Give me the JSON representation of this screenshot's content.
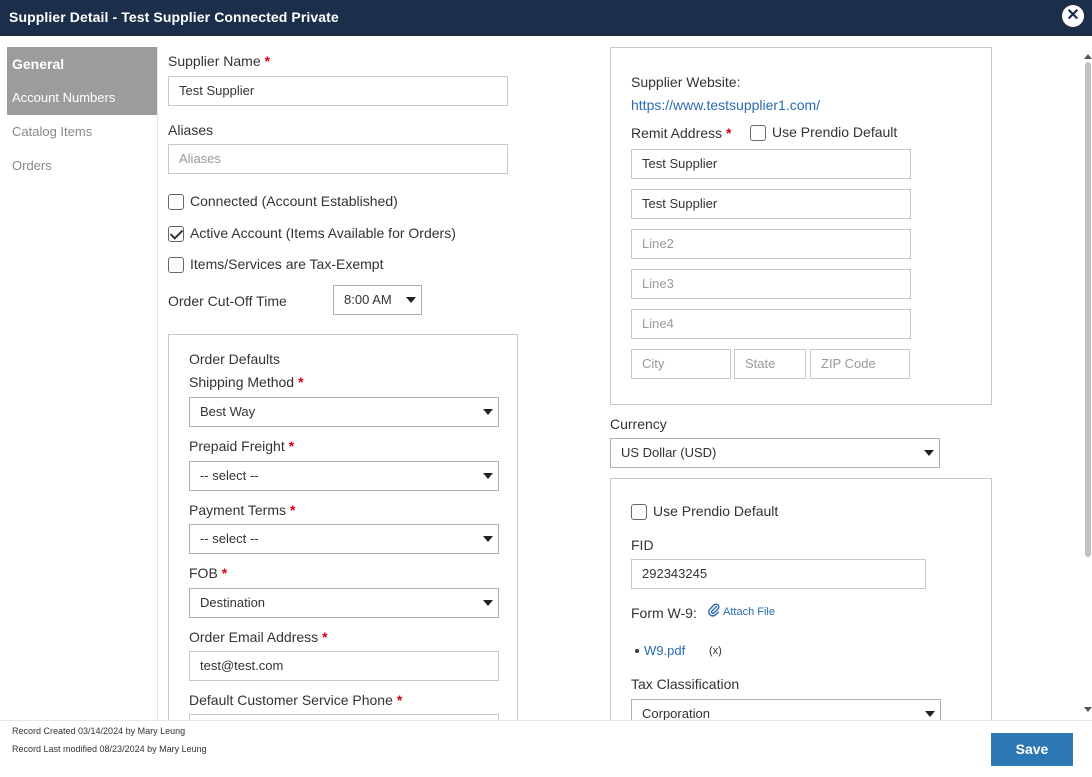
{
  "window": {
    "title": "Supplier Detail - Test Supplier Connected Private"
  },
  "nav": {
    "items": [
      "General",
      "Account Numbers",
      "Catalog Items",
      "Orders"
    ]
  },
  "form": {
    "supplier_name": {
      "label": "Supplier Name",
      "value": "Test Supplier"
    },
    "aliases": {
      "label": "Aliases",
      "placeholder": "Aliases"
    },
    "checkboxes": {
      "connected": {
        "label": "Connected (Account Established)",
        "checked": false
      },
      "active": {
        "label": "Active Account (Items Available for Orders)",
        "checked": true
      },
      "tax_exempt": {
        "label": "Items/Services are Tax-Exempt",
        "checked": false
      }
    },
    "cutoff": {
      "label": "Order Cut-Off Time",
      "value": "8:00 AM"
    }
  },
  "order_defaults": {
    "heading": "Order Defaults",
    "shipping_method": {
      "label": "Shipping Method",
      "value": "Best Way"
    },
    "prepaid_freight": {
      "label": "Prepaid Freight",
      "value": "-- select --"
    },
    "payment_terms": {
      "label": "Payment Terms",
      "value": "-- select --"
    },
    "fob": {
      "label": "FOB",
      "value": "Destination"
    },
    "order_email": {
      "label": "Order Email Address",
      "value": "test@test.com"
    },
    "cs_phone": {
      "label": "Default Customer Service Phone"
    }
  },
  "address": {
    "website_label": "Supplier Website:",
    "website": "https://www.testsupplier1.com/",
    "remit_label": "Remit Address",
    "use_default_label": "Use Prendio Default",
    "line_name": "Test Supplier",
    "line1": "Test Supplier",
    "line2_ph": "Line2",
    "line3_ph": "Line3",
    "line4_ph": "Line4",
    "city_ph": "City",
    "state_ph": "State",
    "zip_ph": "ZIP Code"
  },
  "currency": {
    "label": "Currency",
    "value": "US Dollar (USD)"
  },
  "tax": {
    "use_default_label": "Use Prendio Default",
    "fid_label": "FID",
    "fid_value": "292343245",
    "w9_label": "Form W-9:",
    "attach_label": "Attach File",
    "file_name": "W9.pdf",
    "remove_label": "(x)",
    "classification_label": "Tax Classification",
    "classification_value": "Corporation"
  },
  "footer": {
    "created": "Record Created 03/14/2024 by Mary Leung",
    "modified": "Record Last modified 08/23/2024 by Mary Leung",
    "save_label": "Save"
  },
  "colors": {
    "titlebar": "#1c2f4a",
    "accent": "#2b78b5",
    "required": "#d9000d",
    "link": "#2a6ab0"
  },
  "icons": [
    "close-icon",
    "checkmark-icon",
    "chevron-down-icon",
    "paperclip-icon",
    "bullet-icon",
    "scroll-up-icon",
    "scroll-down-icon"
  ]
}
